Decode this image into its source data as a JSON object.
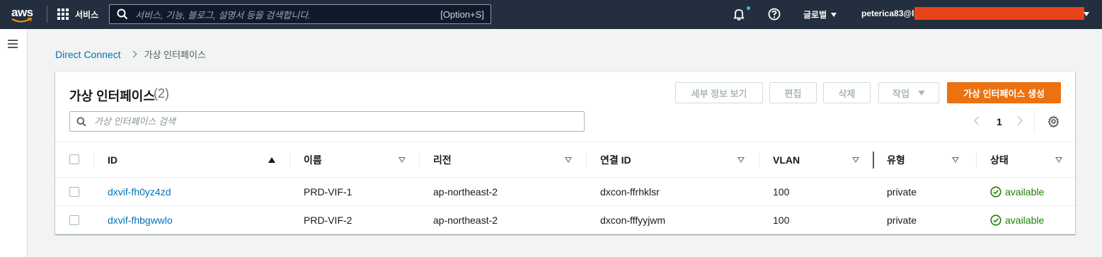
{
  "topnav": {
    "logo_text": "aws",
    "services_label": "서비스",
    "search_placeholder": "서비스, 기능, 블로그, 설명서 등을 검색합니다.",
    "search_shortcut": "[Option+S]",
    "region_label": "글로벌",
    "account_label": "peterica83@lo"
  },
  "breadcrumb": {
    "items": [
      "Direct Connect",
      "가상 인터페이스"
    ]
  },
  "panel": {
    "title": "가상 인터페이스",
    "count": "(2)",
    "buttons": {
      "details": "세부 정보 보기",
      "edit": "편집",
      "delete": "삭제",
      "actions": "작업",
      "create": "가상 인터페이스 생성"
    },
    "filter_placeholder": "가상 인터페이스 검색",
    "page": "1"
  },
  "table": {
    "columns": [
      "ID",
      "이름",
      "리전",
      "연결 ID",
      "VLAN",
      "유형",
      "상태"
    ],
    "sorted_column": "ID",
    "rows": [
      {
        "id": "dxvif-fh0yz4zd",
        "name": "PRD-VIF-1",
        "region": "ap-northeast-2",
        "connection_id": "dxcon-ffrhklsr",
        "vlan": "100",
        "type": "private",
        "status": "available"
      },
      {
        "id": "dxvif-fhbgwwlo",
        "name": "PRD-VIF-2",
        "region": "ap-northeast-2",
        "connection_id": "dxcon-fffyyjwm",
        "vlan": "100",
        "type": "private",
        "status": "available"
      }
    ]
  },
  "colors": {
    "nav_bg": "#232f3e",
    "link": "#0073bb",
    "primary_button": "#ec7211",
    "status_ok": "#1d8102",
    "redaction": "#e8441a"
  }
}
